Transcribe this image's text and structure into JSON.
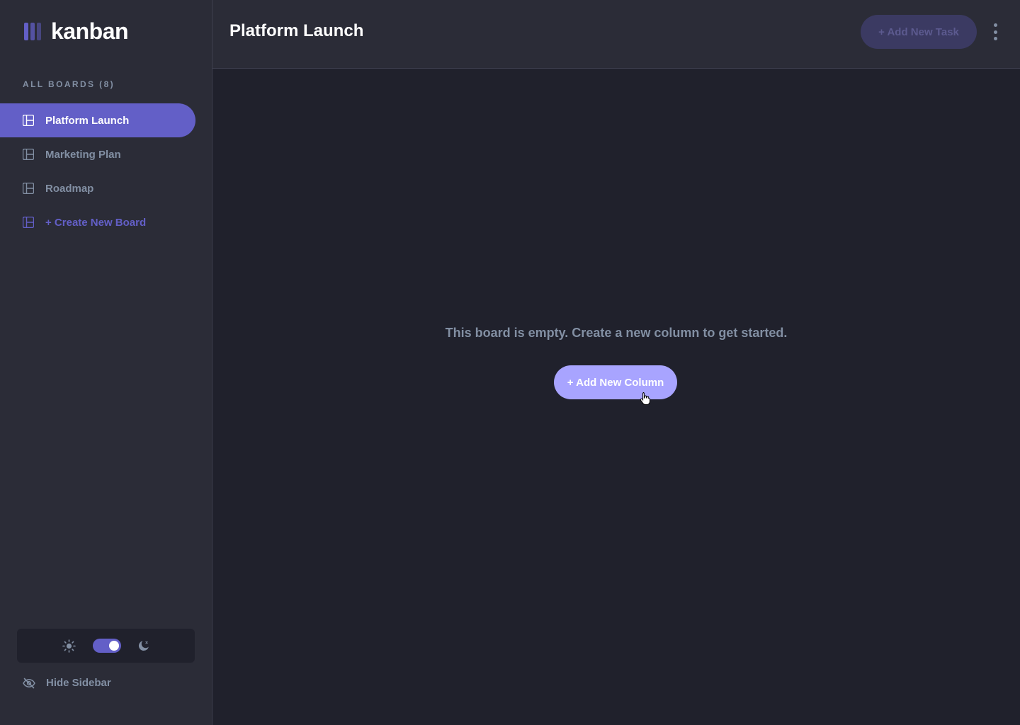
{
  "app": {
    "logo_text": "kanban"
  },
  "sidebar": {
    "heading": "ALL BOARDS (8)",
    "boards": [
      {
        "label": "Platform Launch",
        "active": true
      },
      {
        "label": "Marketing Plan",
        "active": false
      },
      {
        "label": "Roadmap",
        "active": false
      }
    ],
    "create_label": "+ Create New Board",
    "hide_label": "Hide Sidebar",
    "theme": {
      "mode": "dark",
      "light_icon": "sun-icon",
      "dark_icon": "moon-icon"
    }
  },
  "header": {
    "title": "Platform Launch",
    "add_task_label": "+ Add New Task"
  },
  "main": {
    "empty_message": "This board is empty. Create a new column to get started.",
    "add_column_label": "+ Add New Column"
  },
  "colors": {
    "accent": "#635FC7",
    "accent_hover": "#A8A4FF",
    "bg_dark": "#20212C",
    "panel": "#2B2C37",
    "muted_text": "#828FA3"
  }
}
